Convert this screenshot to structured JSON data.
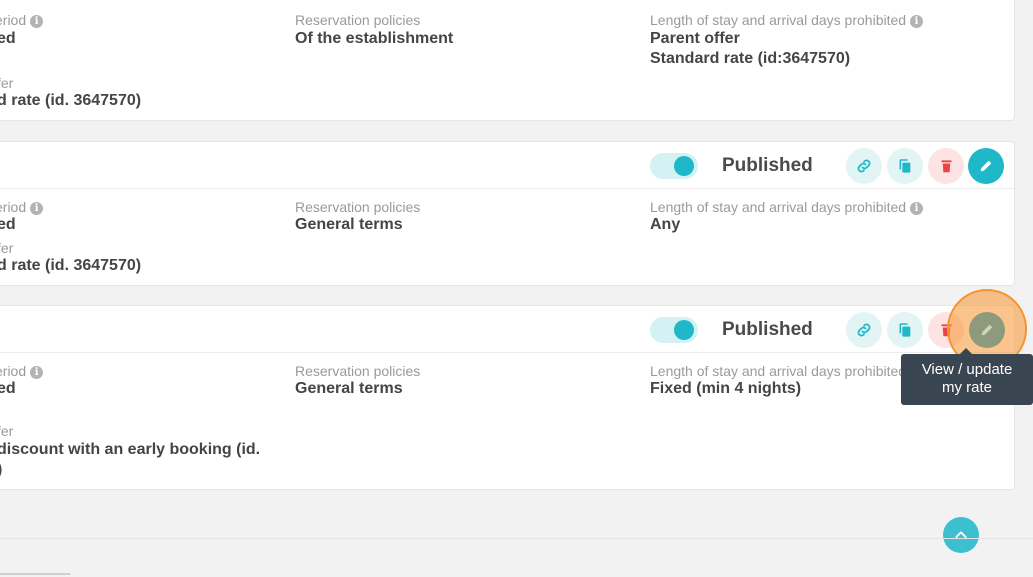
{
  "cards": [
    {
      "period_label": "eriod",
      "period_value": "ed",
      "offer_label": "fer",
      "offer_value": "d rate (id. 3647570)",
      "policy_label": "Reservation policies",
      "policy_value": "Of the establishment",
      "los_label": "Length of stay and arrival days prohibited",
      "los_value_1": "Parent offer",
      "los_value_2": "Standard rate (id:3647570)"
    },
    {
      "status": "Published",
      "period_label": "eriod",
      "period_value": "ed",
      "offer_label": "fer",
      "offer_value": "d rate (id. 3647570)",
      "policy_label": "Reservation policies",
      "policy_value": "General terms",
      "los_label": "Length of stay and arrival days prohibited",
      "los_value_1": "Any"
    },
    {
      "status": "Published",
      "period_label": "eriod",
      "period_value": "ed",
      "offer_label": "fer",
      "offer_value_1": "discount with an early booking (id.",
      "offer_value_2": ")",
      "policy_label": "Reservation policies",
      "policy_value": "General terms",
      "los_label": "Length of stay and arrival days prohibited",
      "los_value_1": "Fixed (min 4 nights)"
    }
  ],
  "info_glyph": "i",
  "tooltip": {
    "line1": "View / update",
    "line2": "my rate"
  },
  "colors": {
    "accent": "#1fb8c9",
    "danger": "#e84545",
    "highlight": "#f7932f",
    "tooltip_bg": "#3a4552"
  },
  "icons": [
    "link-icon",
    "copy-icon",
    "trash-icon",
    "pencil-icon",
    "chevron-up-icon",
    "info-icon"
  ]
}
